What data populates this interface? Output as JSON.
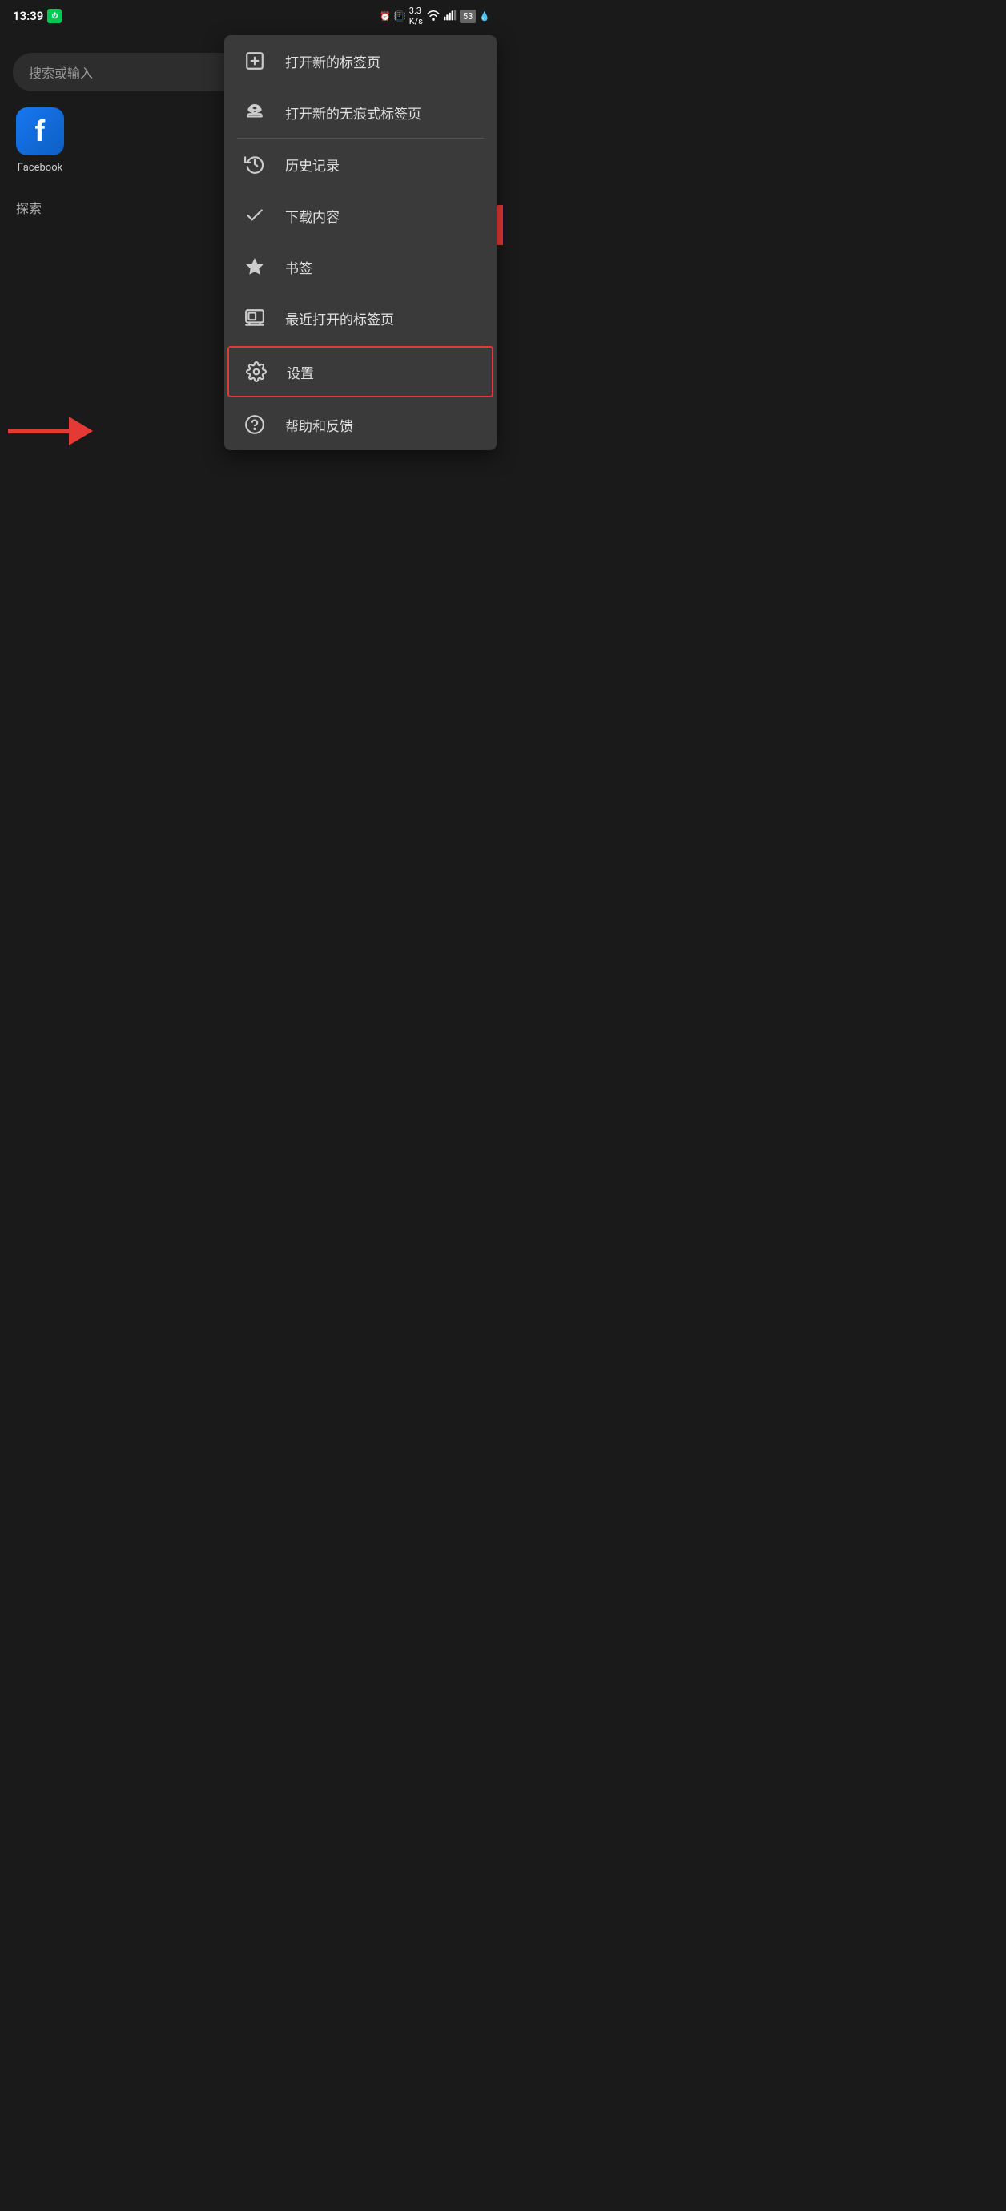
{
  "statusBar": {
    "time": "13:39",
    "battery": "53"
  },
  "background": {
    "searchPlaceholder": "搜索或输入",
    "shortcuts": [
      {
        "label": "Facebook",
        "icon": "f"
      }
    ],
    "exploreLabel": "探索"
  },
  "menu": {
    "items": [
      {
        "id": "new-tab",
        "label": "打开新的标签页",
        "icon": "new-tab-icon"
      },
      {
        "id": "incognito",
        "label": "打开新的无痕式标签页",
        "icon": "incognito-icon"
      },
      {
        "id": "history",
        "label": "历史记录",
        "icon": "history-icon"
      },
      {
        "id": "downloads",
        "label": "下载内容",
        "icon": "download-icon"
      },
      {
        "id": "bookmarks",
        "label": "书签",
        "icon": "bookmark-icon"
      },
      {
        "id": "recent-tabs",
        "label": "最近打开的标签页",
        "icon": "recent-tabs-icon"
      },
      {
        "id": "settings",
        "label": "设置",
        "icon": "settings-icon",
        "highlighted": true
      },
      {
        "id": "help",
        "label": "帮助和反馈",
        "icon": "help-icon"
      }
    ]
  }
}
